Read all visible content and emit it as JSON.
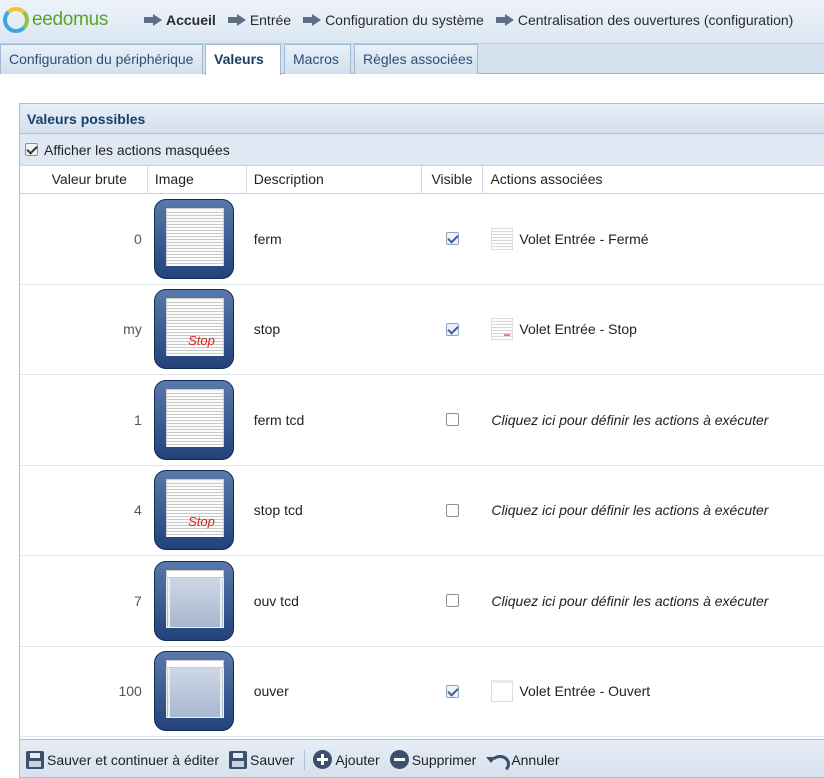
{
  "header": {
    "logo_text": "eedomus",
    "breadcrumb": [
      {
        "label": "Accueil",
        "bold": true
      },
      {
        "label": "Entrée",
        "bold": false
      },
      {
        "label": "Configuration du système",
        "bold": false
      },
      {
        "label": "Centralisation des ouvertures (configuration)",
        "bold": false
      }
    ]
  },
  "tabs": [
    {
      "label": "Configuration du périphérique",
      "active": false
    },
    {
      "label": "Valeurs",
      "active": true
    },
    {
      "label": "Macros",
      "active": false
    },
    {
      "label": "Règles associées",
      "active": false
    }
  ],
  "panel": {
    "title": "Valeurs possibles",
    "show_hidden_label": "Afficher les actions masquées",
    "show_hidden_checked": true,
    "columns": [
      "Valeur brute",
      "Image",
      "Description",
      "Visible",
      "Actions associées"
    ],
    "rows": [
      {
        "raw": "0",
        "image": "shutter-closed-icon",
        "description": "ferm",
        "visible": true,
        "action": "Volet Entrée - Fermé",
        "action_icon": "closed"
      },
      {
        "raw": "my",
        "image": "shutter-stop-icon",
        "stop_text": "Stop",
        "description": "stop",
        "visible": true,
        "action": "Volet Entrée - Stop",
        "action_icon": "stop"
      },
      {
        "raw": "1",
        "image": "shutter-closed-icon",
        "description": "ferm tcd",
        "visible": false,
        "action": "Cliquez ici pour définir les actions à exécuter",
        "action_icon": null
      },
      {
        "raw": "4",
        "image": "shutter-stop-icon",
        "stop_text": "Stop",
        "description": "stop tcd",
        "visible": false,
        "action": "Cliquez ici pour définir les actions à exécuter",
        "action_icon": null
      },
      {
        "raw": "7",
        "image": "shutter-open-icon",
        "description": "ouv tcd",
        "visible": false,
        "action": "Cliquez ici pour définir les actions à exécuter",
        "action_icon": null
      },
      {
        "raw": "100",
        "image": "shutter-open-icon",
        "description": "ouver",
        "visible": true,
        "action": "Volet Entrée - Ouvert",
        "action_icon": "open"
      }
    ]
  },
  "toolbar": {
    "save_continue": "Sauver et continuer à éditer",
    "save": "Sauver",
    "add": "Ajouter",
    "delete": "Supprimer",
    "cancel": "Annuler"
  },
  "colors": {
    "accent": "#15406f",
    "header_bg": "#dbe6f3",
    "image_button": "#23427a",
    "stop_text": "#e02020"
  }
}
